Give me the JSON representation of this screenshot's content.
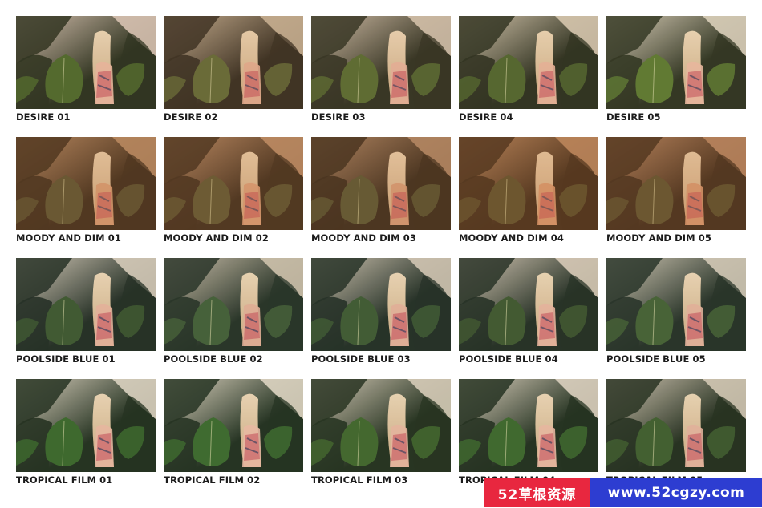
{
  "presets": [
    {
      "label": "DESIRE 01",
      "tone": "#d9c7b8",
      "leaf": "#4f6a2e",
      "dark": "#2b3321",
      "skin": "#e8b7a0",
      "warm": 0.05
    },
    {
      "label": "DESIRE 02",
      "tone": "#c8b79c",
      "leaf": "#5e6a38",
      "dark": "#2f2c22",
      "skin": "#e2ae95",
      "warm": 0.12
    },
    {
      "label": "DESIRE 03",
      "tone": "#d4c6b2",
      "leaf": "#566c32",
      "dark": "#2d3223",
      "skin": "#e4b29c",
      "warm": 0.08
    },
    {
      "label": "DESIRE 04",
      "tone": "#d7ccb6",
      "leaf": "#4f6630",
      "dark": "#2a3122",
      "skin": "#e6b49c",
      "warm": 0.06
    },
    {
      "label": "DESIRE 05",
      "tone": "#dcd3c0",
      "leaf": "#5d7a34",
      "dark": "#2f3624",
      "skin": "#e9b9a2",
      "warm": 0.04
    },
    {
      "label": "MOODY AND DIM 01",
      "tone": "#b48e6c",
      "leaf": "#4b4e30",
      "dark": "#2a2318",
      "skin": "#d69c78",
      "warm": 0.25
    },
    {
      "label": "MOODY AND DIM 02",
      "tone": "#b99170",
      "leaf": "#4f5232",
      "dark": "#2b241a",
      "skin": "#d99f7c",
      "warm": 0.25
    },
    {
      "label": "MOODY AND DIM 03",
      "tone": "#ae8c6e",
      "leaf": "#4c5232",
      "dark": "#29241a",
      "skin": "#d49b7a",
      "warm": 0.22
    },
    {
      "label": "MOODY AND DIM 04",
      "tone": "#b78c68",
      "leaf": "#4a4a2c",
      "dark": "#2b2217",
      "skin": "#d89a74",
      "warm": 0.28
    },
    {
      "label": "MOODY AND DIM 05",
      "tone": "#b48a6a",
      "leaf": "#4a4c2e",
      "dark": "#2a2218",
      "skin": "#d79a76",
      "warm": 0.27
    },
    {
      "label": "POOLSIDE BLUE 01",
      "tone": "#d6cdbd",
      "leaf": "#3f5a33",
      "dark": "#243127",
      "skin": "#e3b29c",
      "warm": 0.02
    },
    {
      "label": "POOLSIDE BLUE 02",
      "tone": "#cfc4b0",
      "leaf": "#43603a",
      "dark": "#263429",
      "skin": "#dfae97",
      "warm": 0.03
    },
    {
      "label": "POOLSIDE BLUE 03",
      "tone": "#d2c8b6",
      "leaf": "#405c36",
      "dark": "#243228",
      "skin": "#e1b09a",
      "warm": 0.02
    },
    {
      "label": "POOLSIDE BLUE 04",
      "tone": "#d9cdbb",
      "leaf": "#3f5932",
      "dark": "#243127",
      "skin": "#e6b49e",
      "warm": 0.03
    },
    {
      "label": "POOLSIDE BLUE 05",
      "tone": "#d3cbb9",
      "leaf": "#466338",
      "dark": "#27352a",
      "skin": "#e1b19b",
      "warm": 0.02
    },
    {
      "label": "TROPICAL FILM 01",
      "tone": "#dcd4c3",
      "leaf": "#3c6a2e",
      "dark": "#233322",
      "skin": "#e7b8a2",
      "warm": 0.02
    },
    {
      "label": "TROPICAL FILM 02",
      "tone": "#dfd7c5",
      "leaf": "#3d6c30",
      "dark": "#233423",
      "skin": "#e8baa4",
      "warm": 0.02
    },
    {
      "label": "TROPICAL FILM 03",
      "tone": "#d8cfbd",
      "leaf": "#41682f",
      "dark": "#243322",
      "skin": "#e5b6a0",
      "warm": 0.03
    },
    {
      "label": "TROPICAL FILM 04",
      "tone": "#ddd3c2",
      "leaf": "#3e6a2f",
      "dark": "#233322",
      "skin": "#e7b8a2",
      "warm": 0.02
    },
    {
      "label": "TROPICAL FILM 05",
      "tone": "#d4cab8",
      "leaf": "#3f5f31",
      "dark": "#243122",
      "skin": "#e2b39d",
      "warm": 0.03
    }
  ],
  "banner": {
    "left_text": "52草根资源",
    "right_text": "www.52cgzy.com",
    "left_color": "#e8273f",
    "right_color": "#2d3dd1"
  }
}
